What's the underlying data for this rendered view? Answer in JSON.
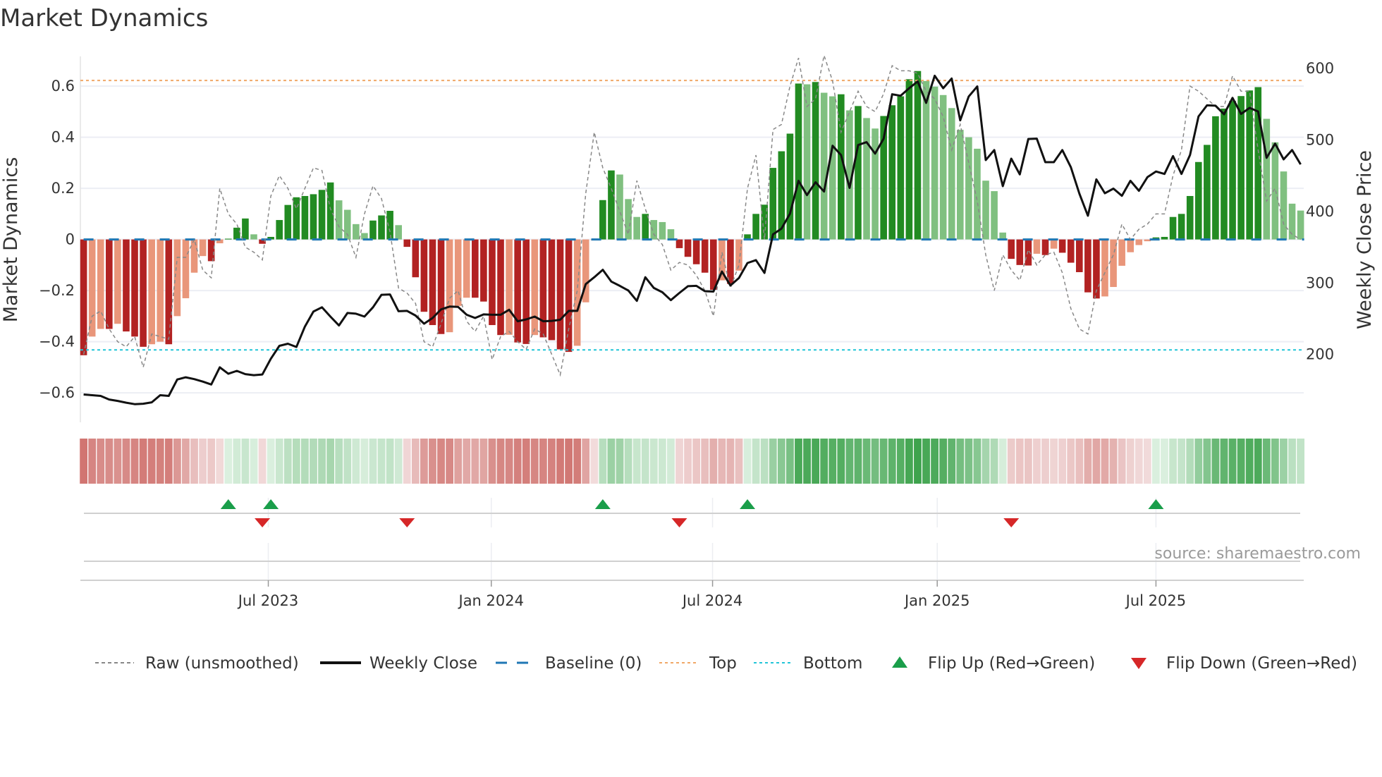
{
  "title": "Market Dynamics",
  "source": "source: sharemaestro.com",
  "colors": {
    "bar_up_strong": "#228b22",
    "bar_up_weak": "#80c080",
    "bar_down_strong": "#b22222",
    "bar_down_weak": "#e9967a",
    "close": "#111111",
    "raw": "#888888",
    "baseline": "#1f77b4",
    "top": "#f0a868",
    "bottom": "#22c5d8",
    "flip_up": "#1a9e4a",
    "flip_down": "#d62728"
  },
  "legend": {
    "raw": "Raw (unsmoothed)",
    "close": "Weekly Close",
    "baseline": "Baseline (0)",
    "top": "Top",
    "bottom": "Bottom",
    "flip_up": "Flip Up (Red→Green)",
    "flip_down": "Flip Down (Green→Red)"
  },
  "chart_data": {
    "type": "bar",
    "title": "Market Dynamics",
    "ylabel": "Market Dynamics",
    "ylabel_right": "Weekly Close Price",
    "xlabel": "",
    "ylim": [
      -0.72,
      0.72
    ],
    "ylim_right": [
      104,
      616
    ],
    "yticks": [
      -0.6,
      -0.4,
      -0.2,
      0,
      0.2,
      0.4,
      0.6
    ],
    "ytick_labels": [
      "−0.6",
      "−0.4",
      "−0.2",
      "0",
      "0.2",
      "0.4",
      "0.6"
    ],
    "yticks_right": [
      200,
      300,
      400,
      500,
      600
    ],
    "ytick_labels_right": [
      "200",
      "300",
      "400",
      "500",
      "600"
    ],
    "x_unit": "week index (weekly bars from late Jan 2023)",
    "xticks": [
      21.7,
      47.9,
      73.9,
      100.3,
      126.0
    ],
    "xtick_labels": [
      "Jul 2023",
      "Jan 2024",
      "Jul 2024",
      "Jan 2025",
      "Jul 2025"
    ],
    "grid": true,
    "legend_position": "bottom",
    "top_threshold": 0.622,
    "bottom_threshold": -0.432,
    "baseline": 0,
    "bars": [
      -0.453,
      -0.38,
      -0.35,
      -0.35,
      -0.33,
      -0.36,
      -0.38,
      -0.42,
      -0.41,
      -0.4,
      -0.41,
      -0.3,
      -0.23,
      -0.13,
      -0.065,
      -0.085,
      -0.015,
      0.003,
      0.046,
      0.082,
      0.02,
      -0.017,
      0.01,
      0.076,
      0.135,
      0.165,
      0.17,
      0.177,
      0.194,
      0.223,
      0.153,
      0.116,
      0.06,
      0.025,
      0.074,
      0.094,
      0.112,
      0.056,
      -0.029,
      -0.148,
      -0.283,
      -0.335,
      -0.37,
      -0.363,
      -0.26,
      -0.228,
      -0.228,
      -0.243,
      -0.335,
      -0.374,
      -0.373,
      -0.403,
      -0.409,
      -0.374,
      -0.383,
      -0.394,
      -0.43,
      -0.44,
      -0.416,
      -0.246,
      -0.003,
      0.154,
      0.27,
      0.254,
      0.158,
      0.088,
      0.1,
      0.076,
      0.068,
      0.04,
      -0.034,
      -0.068,
      -0.097,
      -0.13,
      -0.197,
      -0.16,
      -0.174,
      -0.122,
      0.02,
      0.1,
      0.136,
      0.28,
      0.345,
      0.414,
      0.61,
      0.607,
      0.616,
      0.574,
      0.56,
      0.568,
      0.505,
      0.522,
      0.475,
      0.434,
      0.483,
      0.525,
      0.56,
      0.627,
      0.659,
      0.62,
      0.598,
      0.565,
      0.514,
      0.429,
      0.4,
      0.355,
      0.23,
      0.189,
      0.027,
      -0.076,
      -0.1,
      -0.102,
      -0.056,
      -0.061,
      -0.036,
      -0.052,
      -0.091,
      -0.128,
      -0.207,
      -0.231,
      -0.223,
      -0.186,
      -0.103,
      -0.05,
      -0.022,
      -0.007,
      0.008,
      0.01,
      0.088,
      0.1,
      0.17,
      0.303,
      0.37,
      0.482,
      0.512,
      0.542,
      0.561,
      0.583,
      0.596,
      0.472,
      0.38,
      0.266,
      0.14,
      0.113
    ],
    "raw": [
      -0.45,
      -0.3,
      -0.28,
      -0.35,
      -0.4,
      -0.42,
      -0.38,
      -0.5,
      -0.37,
      -0.38,
      -0.39,
      -0.07,
      -0.07,
      0.0,
      -0.12,
      -0.15,
      0.2,
      0.1,
      0.06,
      -0.03,
      -0.05,
      -0.08,
      0.17,
      0.25,
      0.2,
      0.12,
      0.2,
      0.28,
      0.27,
      0.12,
      0.05,
      0.02,
      -0.07,
      0.1,
      0.21,
      0.16,
      0.03,
      -0.19,
      -0.21,
      -0.25,
      -0.4,
      -0.42,
      -0.33,
      -0.23,
      -0.2,
      -0.32,
      -0.36,
      -0.3,
      -0.47,
      -0.38,
      -0.36,
      -0.4,
      -0.43,
      -0.35,
      -0.37,
      -0.45,
      -0.53,
      -0.35,
      -0.2,
      0.18,
      0.42,
      0.28,
      0.2,
      0.11,
      0.02,
      0.23,
      0.12,
      0.02,
      -0.02,
      -0.12,
      -0.09,
      -0.1,
      -0.14,
      -0.2,
      -0.3,
      -0.05,
      -0.19,
      -0.1,
      0.2,
      0.33,
      0.0,
      0.43,
      0.45,
      0.6,
      0.71,
      0.52,
      0.55,
      0.72,
      0.62,
      0.42,
      0.5,
      0.58,
      0.52,
      0.5,
      0.57,
      0.68,
      0.66,
      0.66,
      0.65,
      0.58,
      0.55,
      0.48,
      0.35,
      0.45,
      0.3,
      0.15,
      -0.06,
      -0.2,
      -0.06,
      -0.12,
      -0.16,
      -0.04,
      -0.1,
      -0.06,
      -0.05,
      -0.13,
      -0.27,
      -0.35,
      -0.37,
      -0.2,
      -0.13,
      -0.06,
      0.06,
      0.0,
      0.04,
      0.06,
      0.1,
      0.1,
      0.25,
      0.35,
      0.6,
      0.58,
      0.55,
      0.52,
      0.52,
      0.64,
      0.58,
      0.58,
      0.35,
      0.15,
      0.2,
      0.06,
      0.02,
      0.0
    ],
    "close": [
      143,
      142,
      141,
      136,
      134,
      131.5,
      129.5,
      130,
      132,
      142,
      141,
      164,
      167,
      164.5,
      161,
      157,
      181,
      172,
      176,
      171.5,
      170,
      171,
      193,
      211,
      214,
      209.5,
      238,
      259,
      265,
      252,
      239.5,
      257,
      256,
      252,
      265,
      282.5,
      283,
      259.5,
      260,
      253.5,
      242,
      250,
      262,
      266,
      265.5,
      254.5,
      250,
      255,
      254.5,
      254.5,
      261.5,
      245.5,
      248,
      252,
      245.5,
      246,
      247.5,
      260,
      260,
      297.5,
      307,
      317.5,
      301,
      295,
      288.5,
      274,
      307,
      292,
      286,
      275,
      285,
      294.5,
      295,
      287.5,
      287,
      315,
      295.5,
      306,
      327,
      331,
      313,
      367,
      375,
      396,
      442,
      422,
      440,
      427,
      491,
      478,
      432,
      492,
      496,
      480,
      501,
      563,
      561,
      571.5,
      581,
      551,
      589,
      571.5,
      585,
      526.5,
      560,
      574,
      471,
      485,
      434.5,
      473,
      451,
      500.5,
      501,
      468,
      468,
      485,
      461,
      424,
      393,
      444,
      424.5,
      431,
      421,
      442,
      428,
      447,
      455,
      451.5,
      476.5,
      451.5,
      478,
      532,
      547.5,
      547,
      535,
      558,
      535.5,
      544,
      539,
      474,
      494,
      472,
      485,
      465
    ],
    "flip_up_indices": [
      17,
      22,
      61,
      78,
      126
    ],
    "flip_down_indices": [
      21,
      38,
      70,
      109
    ]
  }
}
